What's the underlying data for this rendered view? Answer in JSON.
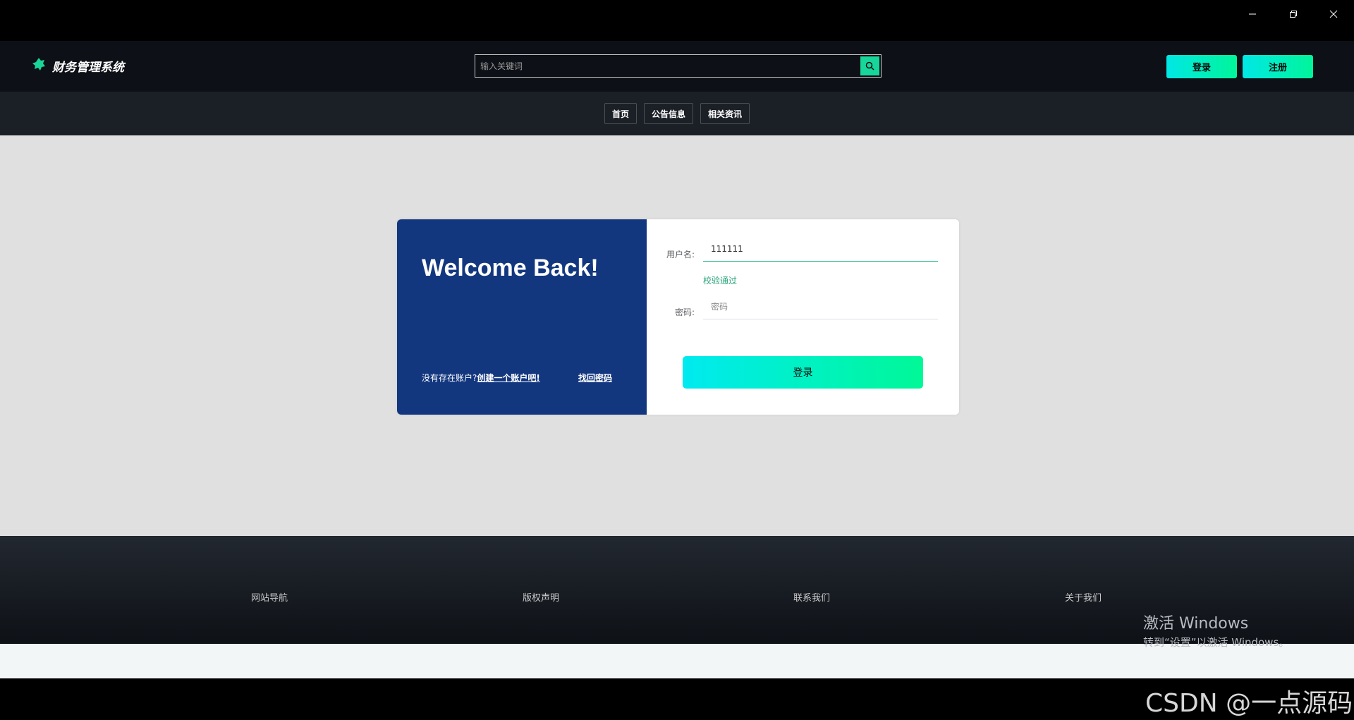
{
  "header": {
    "logo_text": "财务管理系统",
    "search_placeholder": "输入关键词",
    "login_label": "登录",
    "register_label": "注册"
  },
  "nav": {
    "items": [
      {
        "label": "首页"
      },
      {
        "label": "公告信息"
      },
      {
        "label": "相关资讯"
      }
    ]
  },
  "login_card": {
    "welcome": "Welcome Back!",
    "no_account_text": "没有存在账户?",
    "create_account_link": "创建一个账户吧!",
    "find_password_link": "找回密码",
    "username_label": "用户名:",
    "username_value": "111111",
    "validation_text": "校验通过",
    "password_label": "密码:",
    "password_placeholder": "密码",
    "submit_label": "登录"
  },
  "footer": {
    "items": [
      {
        "label": "网站导航"
      },
      {
        "label": "版权声明"
      },
      {
        "label": "联系我们"
      },
      {
        "label": "关于我们"
      }
    ]
  },
  "overlay": {
    "activate_title": "激活 Windows",
    "activate_sub": "转到“设置”以激活 Windows。",
    "watermark": "CSDN @一点源码"
  },
  "colors": {
    "accent_from": "#00e7e5",
    "accent_to": "#00f59a",
    "card_left_bg": "#13377f",
    "validation": "#29a37a"
  }
}
